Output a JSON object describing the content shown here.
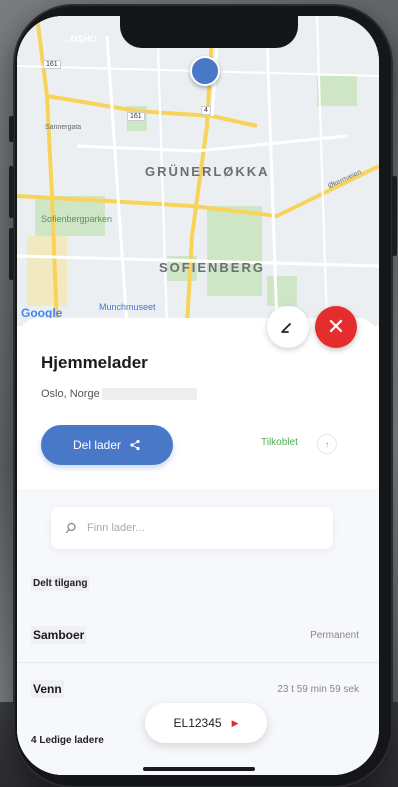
{
  "map": {
    "labels": {
      "district_1": "GRÜNERLØKKA",
      "district_2": "SOFIENBERG",
      "park": "Sofienbergparken",
      "museum": "Munchmuseet",
      "top_label": "...OSHO",
      "road_1": "Sannergata",
      "road_2": "Økernveien",
      "badge_161a": "161",
      "badge_161b": "161",
      "badge_4": "4"
    },
    "attribution": "Google"
  },
  "charger": {
    "title": "Hjemmelader",
    "location": "Oslo, Norge",
    "share_label": "Del lader",
    "status": "Tilkoblet",
    "status_icon_text": "↑"
  },
  "search": {
    "placeholder": "Finn lader..."
  },
  "shared": {
    "heading": "Delt tilgang",
    "rows": [
      {
        "name": "Samboer",
        "meta": "Permanent"
      },
      {
        "name": "Venn",
        "meta": "23 t 59 min 59 sek"
      }
    ]
  },
  "available": {
    "label": "4 Ledige ladere"
  },
  "pill": {
    "code": "EL12345"
  },
  "colors": {
    "accent": "#4a78c9",
    "danger": "#e52d2d",
    "status": "#4caf50"
  }
}
